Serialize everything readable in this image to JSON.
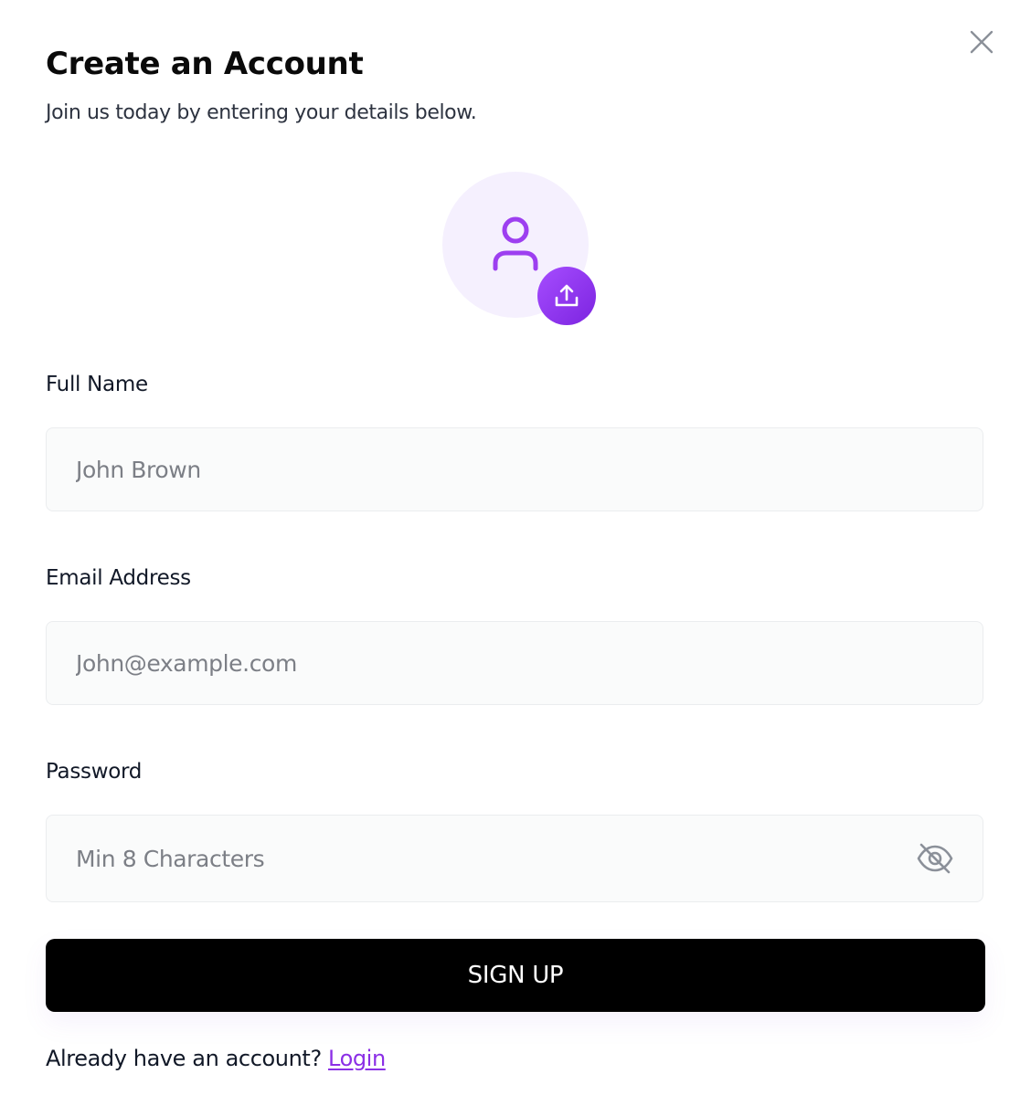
{
  "dialog": {
    "title": "Create an Account",
    "subtitle": "Join us today by entering your details below.",
    "close_icon": "close-icon"
  },
  "avatar": {
    "icon": "user-icon",
    "upload_icon": "upload-icon"
  },
  "form": {
    "full_name": {
      "label": "Full Name",
      "placeholder": "John Brown",
      "value": ""
    },
    "email": {
      "label": "Email Address",
      "placeholder": "John@example.com",
      "value": ""
    },
    "password": {
      "label": "Password",
      "placeholder": "Min 8 Characters",
      "value": "",
      "toggle_icon": "eye-off-icon"
    },
    "submit_label": "SIGN UP"
  },
  "footer": {
    "prompt": "Already have an account?",
    "link_label": "Login"
  },
  "colors": {
    "accent": "#8b2fe6",
    "avatar_bg": "#f5f0fe",
    "button_bg": "#000000",
    "input_bg": "#fafbfb",
    "input_border": "#ebedef"
  }
}
